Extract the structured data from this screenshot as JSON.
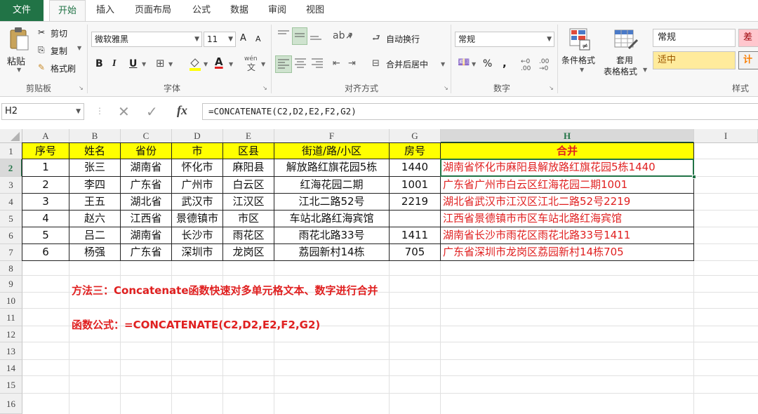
{
  "tabs": [
    "文件",
    "开始",
    "插入",
    "页面布局",
    "公式",
    "数据",
    "审阅",
    "视图"
  ],
  "active_tab": "开始",
  "clipboard": {
    "paste": "粘贴",
    "cut": "剪切",
    "copy": "复制",
    "format_painter": "格式刷",
    "group_label": "剪贴板"
  },
  "font": {
    "name": "微软雅黑",
    "size": "11",
    "bold": "B",
    "italic": "I",
    "underline": "U",
    "group_label": "字体",
    "grow": "A",
    "shrink": "A",
    "phonetic": "wén",
    "font_color_letter": "A"
  },
  "alignment": {
    "wrap_text": "自动换行",
    "merge_center": "合并后居中",
    "group_label": "对齐方式"
  },
  "number": {
    "format": "常规",
    "percent": "%",
    "comma": ",",
    "inc_decimal": "←0 .00",
    "dec_decimal": ".00 →0",
    "group_label": "数字"
  },
  "styles": {
    "conditional_format": "条件格式",
    "table_format_1": "套用",
    "table_format_2": "表格格式",
    "normal": "常规",
    "bad": "差",
    "neutral": "适中",
    "calc": "计",
    "group_label": "样式"
  },
  "formula_bar": {
    "name_box": "H2",
    "fx": "fx",
    "formula": "=CONCATENATE(C2,D2,E2,F2,G2)"
  },
  "columns": [
    "A",
    "B",
    "C",
    "D",
    "E",
    "F",
    "G",
    "H",
    "I"
  ],
  "selected_column": "H",
  "rows": [
    "1",
    "2",
    "3",
    "4",
    "5",
    "6",
    "7",
    "8",
    "9",
    "10",
    "11",
    "12",
    "13",
    "14",
    "15",
    "16"
  ],
  "selected_row": "2",
  "table": {
    "headers": [
      "序号",
      "姓名",
      "省份",
      "市",
      "区县",
      "街道/路/小区",
      "房号",
      "合并"
    ],
    "data": [
      [
        "1",
        "张三",
        "湖南省",
        "怀化市",
        "麻阳县",
        "解放路红旗花园5栋",
        "1440",
        "湖南省怀化市麻阳县解放路红旗花园5栋1440"
      ],
      [
        "2",
        "李四",
        "广东省",
        "广州市",
        "白云区",
        "红海花园二期",
        "1001",
        "广东省广州市白云区红海花园二期1001"
      ],
      [
        "3",
        "王五",
        "湖北省",
        "武汉市",
        "江汉区",
        "江北二路52号",
        "2219",
        "湖北省武汉市江汉区江北二路52号2219"
      ],
      [
        "4",
        "赵六",
        "江西省",
        "景德镇市",
        "市区",
        "车站北路红海宾馆",
        "",
        "江西省景德镇市市区车站北路红海宾馆"
      ],
      [
        "5",
        "吕二",
        "湖南省",
        "长沙市",
        "雨花区",
        "雨花北路33号",
        "1411",
        "湖南省长沙市雨花区雨花北路33号1411"
      ],
      [
        "6",
        "杨强",
        "广东省",
        "深圳市",
        "龙岗区",
        "荔园新村14栋",
        "705",
        "广东省深圳市龙岗区荔园新村14栋705"
      ]
    ]
  },
  "notes": {
    "method": "方法三：Concatenate函数快速对多单元格文本、数字进行合并",
    "formula": "函数公式：=CONCATENATE(C2,D2,E2,F2,G2)"
  },
  "colors": {
    "excel_green": "#217346",
    "header_yellow": "#ffff00",
    "merge_red": "#e02020"
  }
}
